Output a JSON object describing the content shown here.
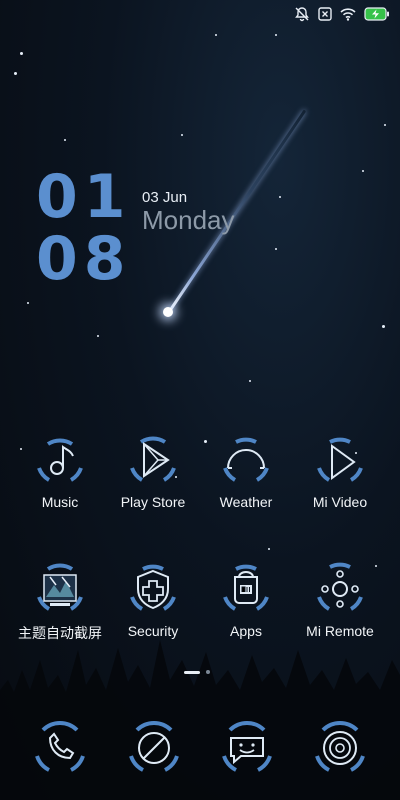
{
  "clock": {
    "hours": "01",
    "minutes": "08"
  },
  "date": {
    "date": "03 Jun",
    "weekday": "Monday"
  },
  "status_bar": {
    "icons": [
      "notifications-off-icon",
      "sim-error-icon",
      "wifi-icon",
      "battery-charging-icon"
    ]
  },
  "apps_row1": [
    {
      "label": "Music",
      "icon": "music-note-icon"
    },
    {
      "label": "Play Store",
      "icon": "play-store-icon"
    },
    {
      "label": "Weather",
      "icon": "weather-icon"
    },
    {
      "label": "Mi Video",
      "icon": "play-triangle-icon"
    }
  ],
  "apps_row2": [
    {
      "label": "主题自动截屏",
      "icon": "screenshot-theme-icon"
    },
    {
      "label": "Security",
      "icon": "shield-plus-icon"
    },
    {
      "label": "Apps",
      "icon": "mi-store-bag-icon"
    },
    {
      "label": "Mi Remote",
      "icon": "remote-control-icon"
    }
  ],
  "dock": [
    {
      "icon": "phone-icon"
    },
    {
      "icon": "browser-globe-icon"
    },
    {
      "icon": "messaging-chat-icon"
    },
    {
      "icon": "camera-lens-icon"
    }
  ],
  "page_indicator": {
    "pages": 2,
    "current": 1
  },
  "colors": {
    "accent": "#4f86c6",
    "icon_stroke": "#dfeaf5",
    "clock": "#5b8fcf"
  }
}
